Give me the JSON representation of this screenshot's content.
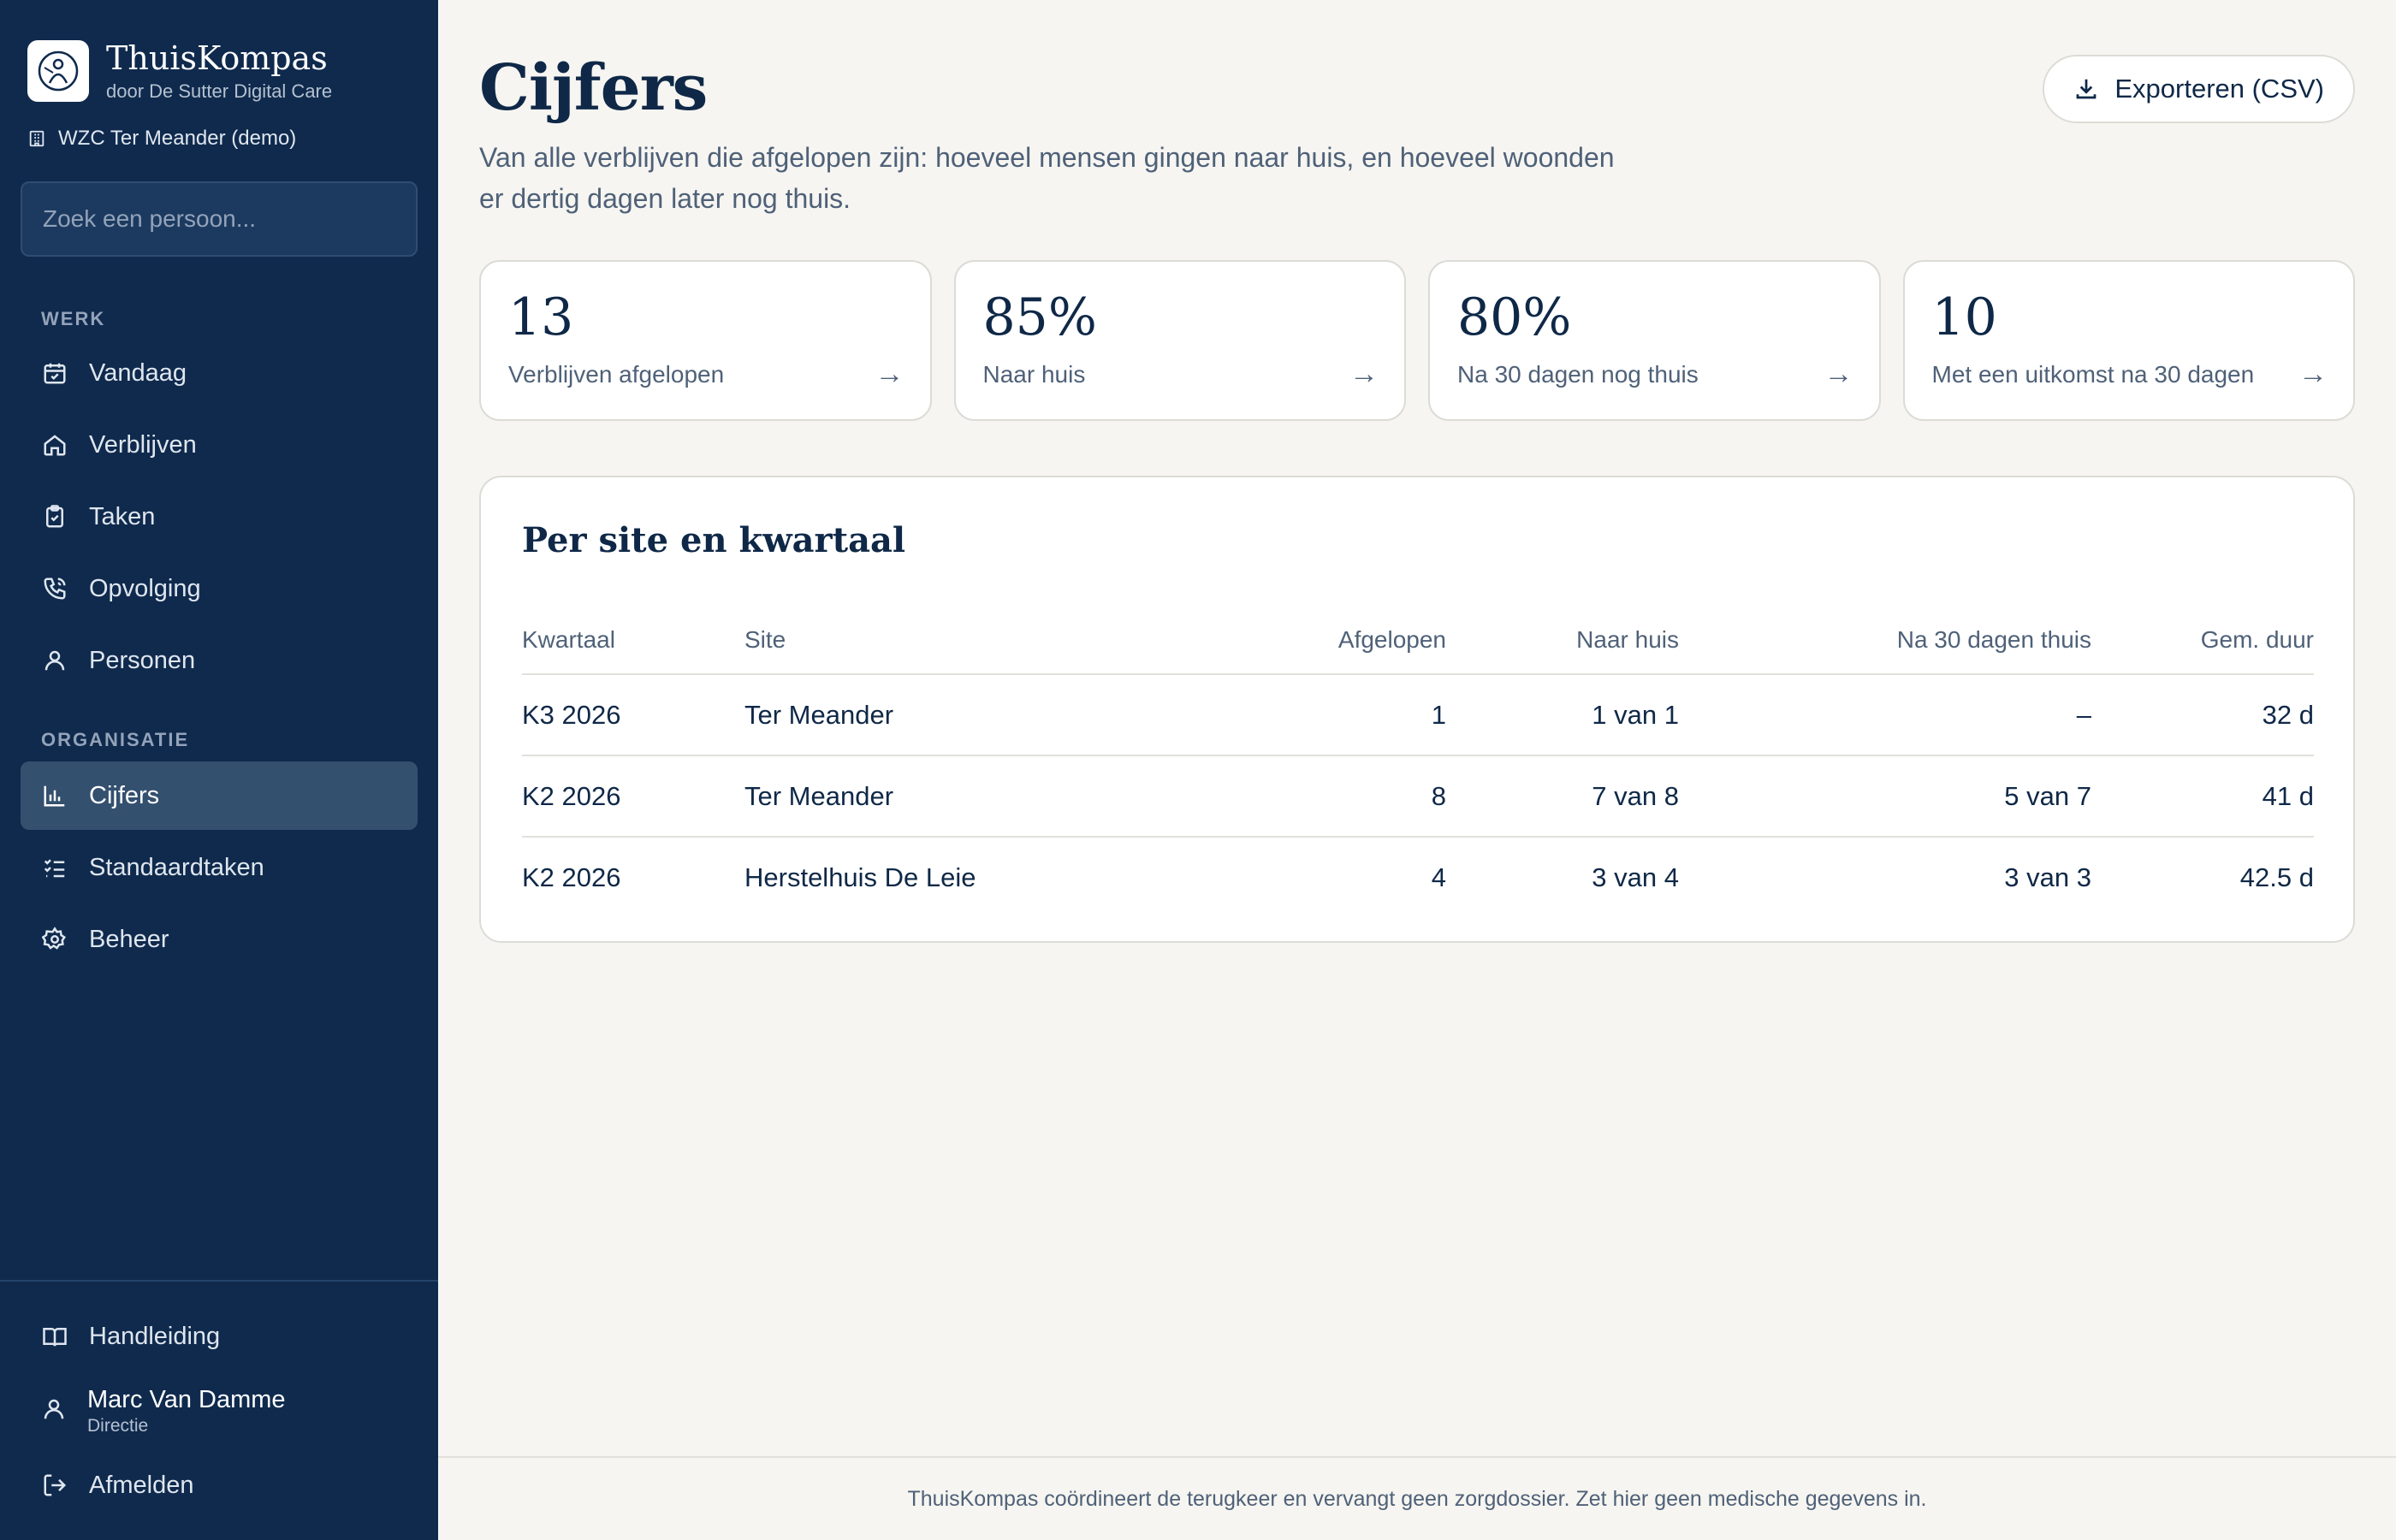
{
  "sidebar": {
    "brand_name": "ThuisKompas",
    "brand_sub": "door De Sutter Digital Care",
    "org": "WZC Ter Meander (demo)",
    "search_placeholder": "Zoek een persoon...",
    "section_work": "WERK",
    "section_org": "ORGANISATIE",
    "items": [
      {
        "label": "Vandaag",
        "icon": "calendar-check-icon"
      },
      {
        "label": "Verblijven",
        "icon": "home-icon"
      },
      {
        "label": "Taken",
        "icon": "clipboard-icon"
      },
      {
        "label": "Opvolging",
        "icon": "phone-icon"
      },
      {
        "label": "Personen",
        "icon": "user-icon"
      },
      {
        "label": "Cijfers",
        "icon": "bar-chart-icon",
        "active": true
      },
      {
        "label": "Standaardtaken",
        "icon": "checklist-icon"
      },
      {
        "label": "Beheer",
        "icon": "gear-icon"
      }
    ],
    "manual": "Handleiding",
    "user_name": "Marc Van Damme",
    "user_role": "Directie",
    "logout": "Afmelden"
  },
  "main": {
    "title": "Cijfers",
    "description": "Van alle verblijven die afgelopen zijn: hoeveel mensen gingen naar huis, en hoeveel woonden er dertig dagen later nog thuis.",
    "export_label": "Exporteren (CSV)",
    "stats": [
      {
        "value": "13",
        "label": "Verblijven afgelopen"
      },
      {
        "value": "85%",
        "label": "Naar huis"
      },
      {
        "value": "80%",
        "label": "Na 30 dagen nog thuis"
      },
      {
        "value": "10",
        "label": "Met een uitkomst na 30 dagen"
      }
    ],
    "stat_arrow": "→",
    "table": {
      "title": "Per site en kwartaal",
      "headers": [
        "Kwartaal",
        "Site",
        "Afgelopen",
        "Naar huis",
        "Na 30 dagen thuis",
        "Gem. duur"
      ],
      "rows": [
        [
          "K3 2026",
          "Ter Meander",
          "1",
          "1 van 1",
          "–",
          "32 d"
        ],
        [
          "K2 2026",
          "Ter Meander",
          "8",
          "7 van 8",
          "5 van 7",
          "41 d"
        ],
        [
          "K2 2026",
          "Herstelhuis De Leie",
          "4",
          "3 van 4",
          "3 van 3",
          "42.5 d"
        ]
      ]
    },
    "footer": "ThuisKompas coördineert de terugkeer en vervangt geen zorgdossier. Zet hier geen medische gegevens in."
  },
  "colors": {
    "sidebar_bg": "#0f2a4d",
    "active_item": "#34506f",
    "page_bg": "#f6f5f1",
    "text_primary": "#0f2847",
    "text_muted": "#4f6178"
  }
}
